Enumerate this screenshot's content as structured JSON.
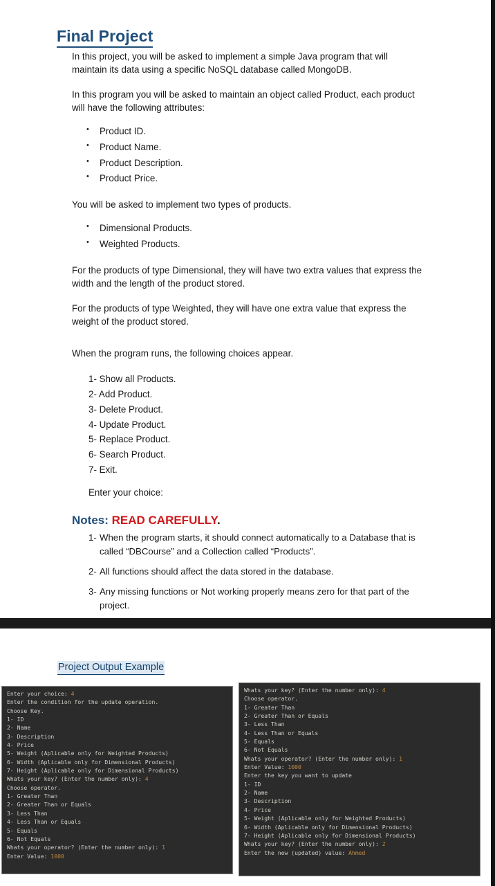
{
  "document": {
    "title": "Final Project",
    "intro_1": "In this project, you will be asked to implement a simple Java program that will maintain its data using a specific NoSQL database called MongoDB.",
    "intro_2": "In this program you will be asked to maintain an object called Product, each product will have the following attributes:",
    "attributes": [
      "Product ID.",
      "Product Name.",
      "Product Description.",
      "Product Price."
    ],
    "types_intro": "You will be asked to implement two types of products.",
    "product_types": [
      "Dimensional Products.",
      "Weighted Products."
    ],
    "dimensional_desc": "For the products of type Dimensional, they will have two extra values that express the width and the length of the product stored.",
    "weighted_desc": "For the products of type Weighted, they will have one extra value that express the weight of the product stored.",
    "menu_intro": "When the program runs, the following choices appear.",
    "menu_items": [
      "1- Show all Products.",
      "2- Add Product.",
      "3- Delete Product.",
      "4- Update Product.",
      "5- Replace Product.",
      "6- Search Product.",
      "7- Exit."
    ],
    "choice_prompt": "Enter your choice:",
    "notes_heading": {
      "word": "Notes",
      "colon": ": ",
      "warning": "READ CAREFULLY",
      "dot": "."
    },
    "notes": [
      {
        "num": "1-",
        "text": "When the program starts, it should connect automatically to a Database that is called “DBCourse” and a Collection called “Products”."
      },
      {
        "num": "2-",
        "text": "All functions should affect the data stored in the database."
      },
      {
        "num": "3-",
        "text": "Any missing functions or Not working properly means zero for that part of the project."
      }
    ]
  },
  "output_page": {
    "title": "Project Output Example",
    "terminal_left": {
      "lines": [
        {
          "text": "Enter your choice: ",
          "value": "4"
        },
        {
          "text": "Enter the condition for the update operation.",
          "value": ""
        },
        {
          "text": "Choose Key.",
          "value": ""
        },
        {
          "text": "1- ID",
          "value": ""
        },
        {
          "text": "2- Name",
          "value": ""
        },
        {
          "text": "3- Description",
          "value": ""
        },
        {
          "text": "4- Price",
          "value": ""
        },
        {
          "text": "5- Weight (Aplicable only for Weighted Products)",
          "value": ""
        },
        {
          "text": "6- Width (Aplicable only for Dimensional Products)",
          "value": ""
        },
        {
          "text": "7- Height (Aplicable only for Dimensional Products)",
          "value": ""
        },
        {
          "text": "Whats your key? (Enter the number only): ",
          "value": "4"
        },
        {
          "text": "Choose operator.",
          "value": ""
        },
        {
          "text": "1- Greater Than",
          "value": ""
        },
        {
          "text": "2- Greater Than or Equals",
          "value": ""
        },
        {
          "text": "3- Less Than",
          "value": ""
        },
        {
          "text": "4- Less Than or Equals",
          "value": ""
        },
        {
          "text": "5- Equals",
          "value": ""
        },
        {
          "text": "6- Not Equals",
          "value": ""
        },
        {
          "text": "Whats your operator? (Enter the number only): ",
          "value": "1"
        },
        {
          "text": "Enter Value: ",
          "value": "1000"
        }
      ]
    },
    "terminal_right": {
      "lines": [
        {
          "text": "Whats your key? (Enter the number only): ",
          "value": "4"
        },
        {
          "text": "Choose operator.",
          "value": ""
        },
        {
          "text": "1- Greater Than",
          "value": ""
        },
        {
          "text": "2- Greater Than or Equals",
          "value": ""
        },
        {
          "text": "3- Less Than",
          "value": ""
        },
        {
          "text": "4- Less Than or Equals",
          "value": ""
        },
        {
          "text": "5- Equals",
          "value": ""
        },
        {
          "text": "6- Not Equals",
          "value": ""
        },
        {
          "text": "Whats your operator? (Enter the number only): ",
          "value": "1"
        },
        {
          "text": "Enter Value: ",
          "value": "1000"
        },
        {
          "text": "Enter the key you want to update",
          "value": ""
        },
        {
          "text": "1- ID",
          "value": ""
        },
        {
          "text": "2- Name",
          "value": ""
        },
        {
          "text": "3- Description",
          "value": ""
        },
        {
          "text": "4- Price",
          "value": ""
        },
        {
          "text": "5- Weight (Aplicable only for Weighted Products)",
          "value": ""
        },
        {
          "text": "6- Width (Aplicable only for Dimensional Products)",
          "value": ""
        },
        {
          "text": "7- Height (Aplicable only for Dimensional Products)",
          "value": ""
        },
        {
          "text": "Whats your key? (Enter the number only): ",
          "value": "2"
        },
        {
          "text": "Enter the new (updated) value: ",
          "value": "Ahmed"
        }
      ]
    }
  },
  "colors": {
    "title_blue": "#1F4E79",
    "warning_red": "#D0181B",
    "link_blue": "#13406B",
    "terminal_bg": "#2B2B2B",
    "terminal_text": "#CFCFC8",
    "terminal_value": "#C28A3E"
  }
}
